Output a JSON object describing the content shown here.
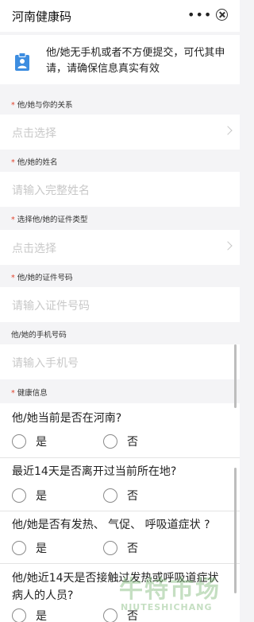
{
  "header": {
    "title": "河南健康码",
    "more_icon": "more-dots-icon",
    "close_icon": "close-circle-icon"
  },
  "notice": {
    "icon": "clipboard-user-icon",
    "text": "他/她无手机或者不方便提交，可代其申请，请确保信息真实有效",
    "icon_color": "#3d8de0"
  },
  "required_mark": "*",
  "form": {
    "relation": {
      "label": "他/她与你的关系",
      "placeholder": "点击选择"
    },
    "name": {
      "label": "他/她的姓名",
      "placeholder": "请输入完整姓名"
    },
    "id_type": {
      "label": "选择他/她的证件类型",
      "placeholder": "点击选择"
    },
    "id_number": {
      "label": "他/她的证件号码",
      "placeholder": "请输入证件号码"
    },
    "phone": {
      "label": "他/她的手机号码",
      "placeholder": "请输入手机号"
    }
  },
  "health": {
    "section_label": "健康信息",
    "questions": [
      {
        "text": "他/她当前是否在河南?",
        "yes": "是",
        "no": "否"
      },
      {
        "text": "最近14天是否离开过当前所在地?",
        "yes": "是",
        "no": "否"
      },
      {
        "text": "他/她是否有发热、 气促、 呼吸道症状 ?",
        "yes": "是",
        "no": "否"
      },
      {
        "text": "他/她近14天是否接触过发热或呼吸道症状病人的人员?",
        "yes": "是",
        "no": "否"
      }
    ]
  },
  "watermark": {
    "big": "牛特市场",
    "small": "NIUTESHICHANG"
  },
  "colors": {
    "required": "#e2432d",
    "background": "#f4f4f6",
    "placeholder": "#c8c8c8"
  }
}
